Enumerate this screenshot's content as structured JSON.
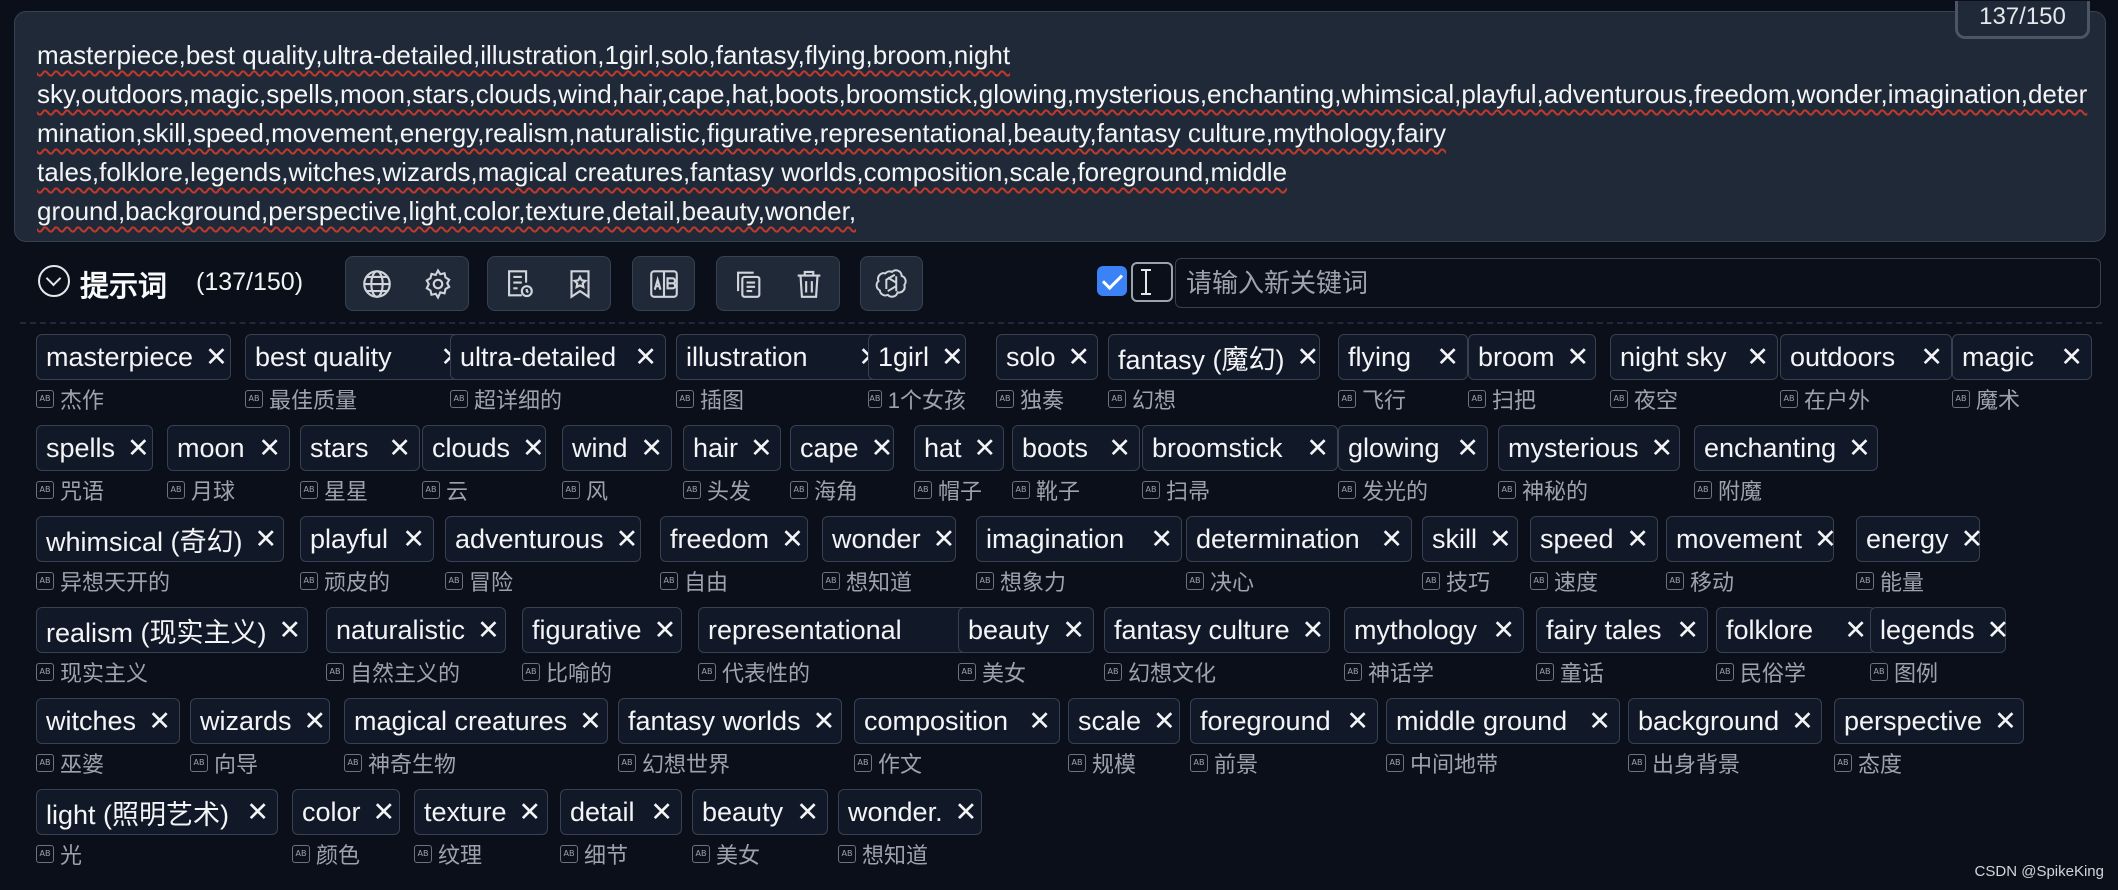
{
  "prompt": {
    "text": "masterpiece,best quality,ultra-detailed,illustration,1girl,solo,fantasy,flying,broom,night\nsky,outdoors,magic,spells,moon,stars,clouds,wind,hair,cape,hat,boots,broomstick,glowing,mysterious,enchanting,whimsical,playful,adventurous,freedom,wonder,imagination,determination,skill,speed,movement,energy,realism,naturalistic,figurative,representational,beauty,fantasy culture,mythology,fairy\ntales,folklore,legends,witches,wizards,magical creatures,fantasy worlds,composition,scale,foreground,middle\nground,background,perspective,light,color,texture,detail,beauty,wonder,",
    "token_counter": "137/150"
  },
  "toolbar": {
    "title": "提示词",
    "count": "(137/150)",
    "buttons": [
      "globe-icon",
      "gear-icon",
      "history-list-icon",
      "bookmark-icon",
      "translate-icon",
      "copy-icon",
      "trash-icon",
      "openai-icon"
    ],
    "auto_translate_checked": true,
    "keyword_placeholder": "请输入新关键词"
  },
  "tags": [
    [
      {
        "label": "masterpiece",
        "trans": "杰作"
      },
      {
        "label": "best quality",
        "trans": "最佳质量"
      },
      {
        "label": "ultra-detailed",
        "trans": "超详细的"
      },
      {
        "label": "illustration",
        "trans": "插图"
      },
      {
        "label": "1girl",
        "trans": "1个女孩"
      },
      {
        "label": "solo",
        "trans": "独奏"
      },
      {
        "label": "fantasy (魔幻)",
        "trans": "幻想"
      },
      {
        "label": "flying",
        "trans": "飞行"
      },
      {
        "label": "broom",
        "trans": "扫把"
      },
      {
        "label": "night sky",
        "trans": "夜空"
      },
      {
        "label": "outdoors",
        "trans": "在户外"
      },
      {
        "label": "magic",
        "trans": "魔术"
      }
    ],
    [
      {
        "label": "spells",
        "trans": "咒语"
      },
      {
        "label": "moon",
        "trans": "月球"
      },
      {
        "label": "stars",
        "trans": "星星"
      },
      {
        "label": "clouds",
        "trans": "云"
      },
      {
        "label": "wind",
        "trans": "风"
      },
      {
        "label": "hair",
        "trans": "头发"
      },
      {
        "label": "cape",
        "trans": "海角"
      },
      {
        "label": "hat",
        "trans": "帽子"
      },
      {
        "label": "boots",
        "trans": "靴子"
      },
      {
        "label": "broomstick",
        "trans": "扫帚"
      },
      {
        "label": "glowing",
        "trans": "发光的"
      },
      {
        "label": "mysterious",
        "trans": "神秘的"
      },
      {
        "label": "enchanting",
        "trans": "附魔"
      }
    ],
    [
      {
        "label": "whimsical (奇幻)",
        "trans": "异想天开的"
      },
      {
        "label": "playful",
        "trans": "顽皮的"
      },
      {
        "label": "adventurous",
        "trans": "冒险"
      },
      {
        "label": "freedom",
        "trans": "自由"
      },
      {
        "label": "wonder",
        "trans": "想知道"
      },
      {
        "label": "imagination",
        "trans": "想象力"
      },
      {
        "label": "determination",
        "trans": "决心"
      },
      {
        "label": "skill",
        "trans": "技巧"
      },
      {
        "label": "speed",
        "trans": "速度"
      },
      {
        "label": "movement",
        "trans": "移动"
      },
      {
        "label": "energy",
        "trans": "能量"
      }
    ],
    [
      {
        "label": "realism (现实主义)",
        "trans": "现实主义"
      },
      {
        "label": "naturalistic",
        "trans": "自然主义的"
      },
      {
        "label": "figurative",
        "trans": "比喻的"
      },
      {
        "label": "representational",
        "trans": "代表性的"
      },
      {
        "label": "beauty",
        "trans": "美女"
      },
      {
        "label": "fantasy culture",
        "trans": "幻想文化"
      },
      {
        "label": "mythology",
        "trans": "神话学"
      },
      {
        "label": "fairy tales",
        "trans": "童话"
      },
      {
        "label": "folklore",
        "trans": "民俗学"
      },
      {
        "label": "legends",
        "trans": "图例"
      }
    ],
    [
      {
        "label": "witches",
        "trans": "巫婆"
      },
      {
        "label": "wizards",
        "trans": "向导"
      },
      {
        "label": "magical creatures",
        "trans": "神奇生物"
      },
      {
        "label": "fantasy worlds",
        "trans": "幻想世界"
      },
      {
        "label": "composition",
        "trans": "作文"
      },
      {
        "label": "scale",
        "trans": "规模"
      },
      {
        "label": "foreground",
        "trans": "前景"
      },
      {
        "label": "middle ground",
        "trans": "中间地带"
      },
      {
        "label": "background",
        "trans": "出身背景"
      },
      {
        "label": "perspective",
        "trans": "态度"
      }
    ],
    [
      {
        "label": "light (照明艺术)",
        "trans": "光"
      },
      {
        "label": "color",
        "trans": "颜色"
      },
      {
        "label": "texture",
        "trans": "纹理"
      },
      {
        "label": "detail",
        "trans": "细节"
      },
      {
        "label": "beauty",
        "trans": "美女"
      },
      {
        "label": "wonder.",
        "trans": "想知道"
      }
    ]
  ],
  "watermark": "CSDN @SpikeKing"
}
